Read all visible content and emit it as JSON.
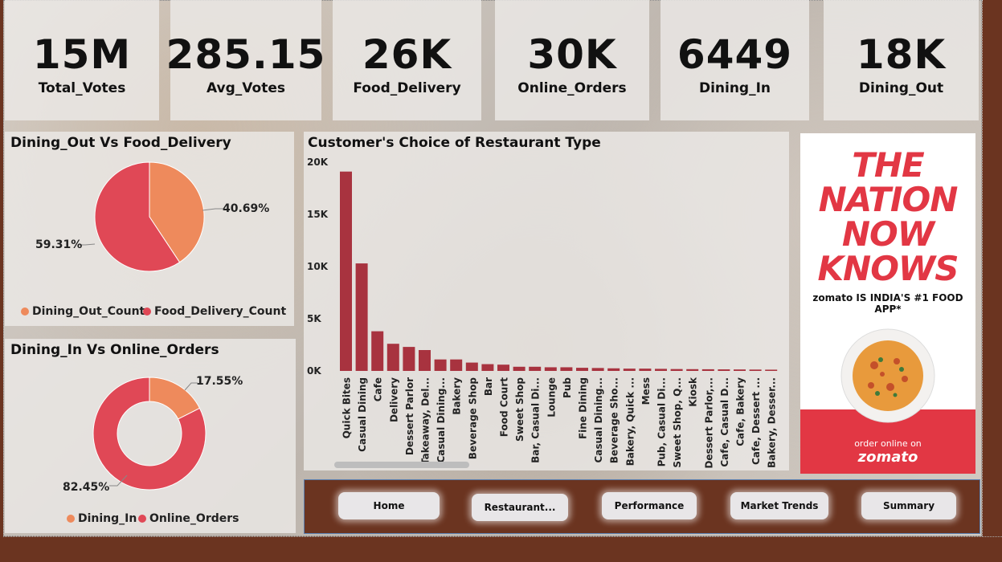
{
  "kpis": [
    {
      "value": "15M",
      "label": "Total_Votes"
    },
    {
      "value": "285.15",
      "label": "Avg_Votes"
    },
    {
      "value": "26K",
      "label": "Food_Delivery"
    },
    {
      "value": "30K",
      "label": "Online_Orders"
    },
    {
      "value": "6449",
      "label": "Dining_In"
    },
    {
      "value": "18K",
      "label": "Dining_Out"
    }
  ],
  "pie1": {
    "title": "Dining_Out Vs Food_Delivery",
    "legend": [
      "Dining_Out_Count",
      "Food_Delivery_Count"
    ],
    "pct_a": "40.69%",
    "pct_b": "59.31%",
    "colors": [
      "#ee8a5c",
      "#e04856"
    ]
  },
  "pie2": {
    "title": "Dining_In Vs Online_Orders",
    "legend": [
      "Dining_In",
      "Online_Orders"
    ],
    "pct_a": "17.55%",
    "pct_b": "82.45%",
    "colors": [
      "#ee8a5c",
      "#e04856"
    ]
  },
  "chart_data": [
    {
      "type": "pie",
      "title": "Dining_Out Vs Food_Delivery",
      "labels": [
        "Dining_Out_Count",
        "Food_Delivery_Count"
      ],
      "values": [
        40.69,
        59.31
      ],
      "legend": "bottom"
    },
    {
      "type": "pie",
      "title": "Dining_In Vs Online_Orders",
      "labels": [
        "Dining_In",
        "Online_Orders"
      ],
      "values": [
        17.55,
        82.45
      ],
      "legend": "bottom"
    },
    {
      "type": "bar",
      "title": "Customer's Choice of Restaurant Type",
      "ylim": [
        0,
        20000
      ],
      "yticks": [
        "0K",
        "5K",
        "10K",
        "15K",
        "20K"
      ],
      "yticks_values": [
        0,
        5000,
        10000,
        15000,
        20000
      ],
      "grid": false,
      "color": "#a8333f",
      "categories": [
        "Quick Bites",
        "Casual Dining",
        "Cafe",
        "Delivery",
        "Dessert Parlor",
        "Takeaway, Del...",
        "Casual Dining...",
        "Bakery",
        "Beverage Shop",
        "Bar",
        "Food Court",
        "Sweet Shop",
        "Bar, Casual Di...",
        "Lounge",
        "Pub",
        "Fine Dining",
        "Casual Dining...",
        "Beverage Sho...",
        "Bakery, Quick ...",
        "Mess",
        "Pub, Casual Di...",
        "Sweet Shop, Q...",
        "Kiosk",
        "Dessert Parlor,...",
        "Cafe, Casual D...",
        "Cafe, Bakery",
        "Cafe, Dessert ...",
        "Bakery, Desser..."
      ],
      "values": [
        19100,
        10300,
        3800,
        2600,
        2300,
        2000,
        1100,
        1100,
        800,
        650,
        600,
        400,
        400,
        350,
        350,
        300,
        280,
        250,
        220,
        220,
        200,
        180,
        170,
        160,
        150,
        140,
        130,
        120
      ]
    }
  ],
  "ad": {
    "line1": "THE",
    "line2": "NATION",
    "line3": "NOW",
    "line4": "KNOWS",
    "sub": "zomato IS INDIA'S #1 FOOD APP*",
    "order": "order online on",
    "brand": "zomato"
  },
  "nav": [
    "Home",
    "Restaurant...",
    "Performance",
    "Market Trends",
    "Summary"
  ]
}
